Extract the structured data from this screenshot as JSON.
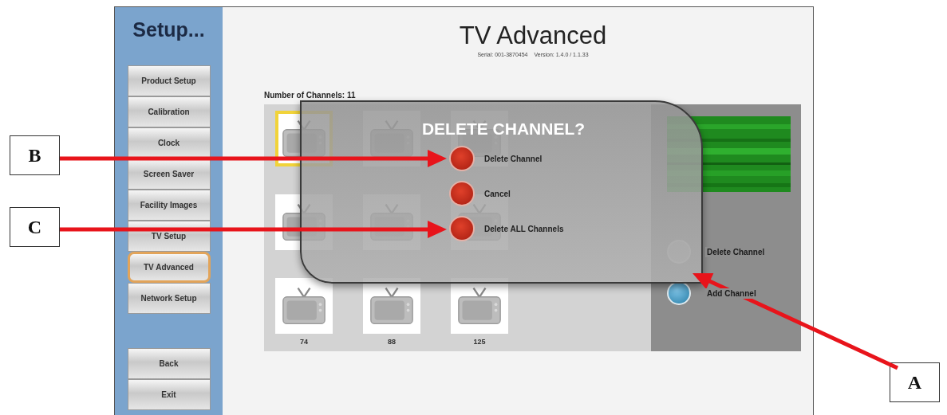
{
  "sidebar": {
    "title": "Setup...",
    "items": [
      {
        "label": "Product Setup",
        "selected": false
      },
      {
        "label": "Calibration",
        "selected": false
      },
      {
        "label": "Clock",
        "selected": false
      },
      {
        "label": "Screen Saver",
        "selected": false
      },
      {
        "label": "Facility Images",
        "selected": false
      },
      {
        "label": "TV Setup",
        "selected": false
      },
      {
        "label": "TV Advanced",
        "selected": true
      },
      {
        "label": "Network Setup",
        "selected": false
      }
    ],
    "bottom_items": [
      {
        "label": "Back"
      },
      {
        "label": "Exit"
      }
    ]
  },
  "header": {
    "title": "TV Advanced",
    "serial": "Serial: 001-3870454",
    "version": "Version: 1.4.0 / 1.1.33"
  },
  "channel_count": "Number of Channels: 11",
  "channels": [
    {
      "selected": true
    },
    {
      "selected": false
    },
    {
      "selected": false
    },
    {
      "selected": false
    },
    {
      "selected": false
    },
    {
      "selected": false
    },
    {
      "label": "74",
      "selected": false
    },
    {
      "label": "88",
      "selected": false
    },
    {
      "label": "125",
      "selected": false
    }
  ],
  "actions": [
    {
      "label": "Delete Channel",
      "disabled": true
    },
    {
      "label": "Add Channel",
      "disabled": false
    }
  ],
  "dialog": {
    "title": "DELETE CHANNEL?",
    "options": [
      {
        "label": "Delete Channel"
      },
      {
        "label": "Cancel"
      },
      {
        "label": "Delete ALL Channels"
      }
    ]
  },
  "callouts": [
    {
      "letter": "B"
    },
    {
      "letter": "C"
    },
    {
      "letter": "A"
    }
  ]
}
